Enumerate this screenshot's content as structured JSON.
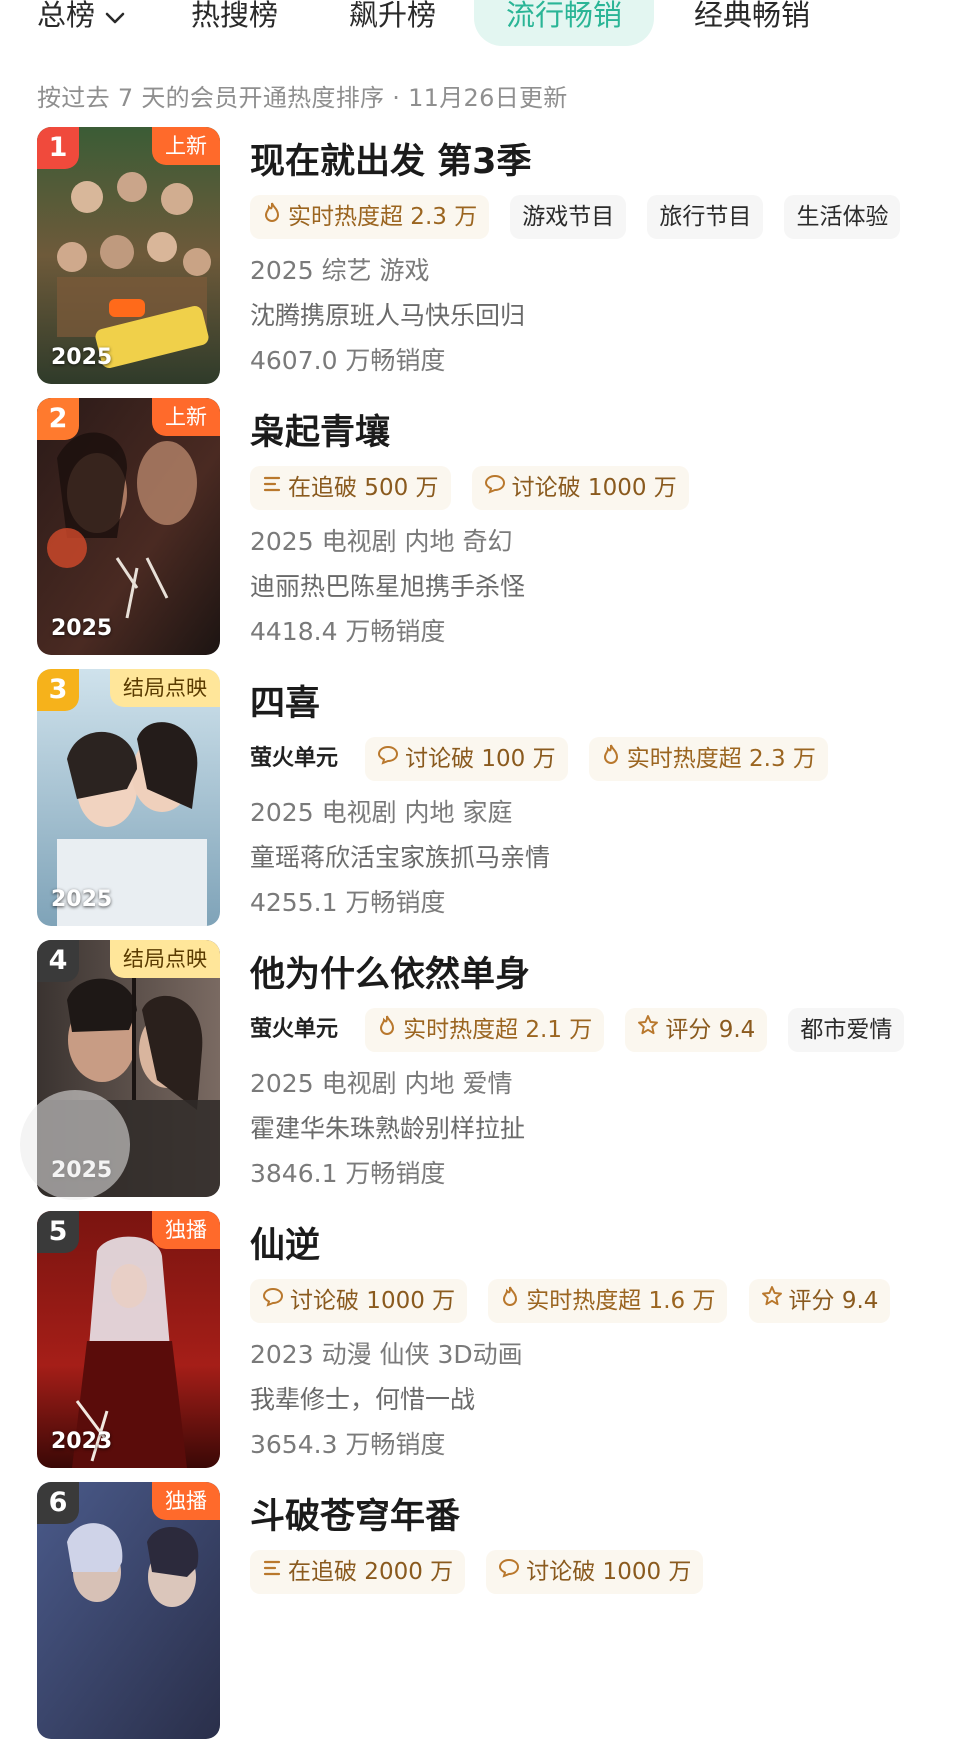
{
  "tabs": [
    {
      "label": "总榜"
    },
    {
      "label": "热搜榜"
    },
    {
      "label": "飙升榜"
    },
    {
      "label": "流行畅销",
      "active": true
    },
    {
      "label": "经典畅销"
    }
  ],
  "subtitle": "按过去 7 天的会员开通热度排序 · 11月26日更新",
  "colors": {
    "accent": "#2ab596",
    "rank1": "#f04a3c",
    "rank2": "#ff7a2e",
    "rank3": "#f6b21b",
    "rank_other": "#3a3a3a",
    "badge": "#ff6a2b"
  },
  "items": [
    {
      "rank": "1",
      "badge": "上新",
      "year": "2025",
      "title": "现在就出发 第3季",
      "tags": [
        {
          "icon": "flame-icon",
          "text": "实时热度超 2.3 万"
        },
        {
          "text": "游戏节目"
        },
        {
          "text": "旅行节目"
        },
        {
          "text": "生活体验"
        }
      ],
      "genre": "2025 综艺 游戏",
      "desc": "沈腾携原班人马快乐回归",
      "sales": "4607.0 万畅销度"
    },
    {
      "rank": "2",
      "badge": "上新",
      "year": "2025",
      "title": "枭起青壤",
      "tags": [
        {
          "icon": "list-icon",
          "text": "在追破 500 万"
        },
        {
          "icon": "chat-icon",
          "text": "讨论破 1000 万"
        }
      ],
      "genre": "2025 电视剧 内地 奇幻",
      "desc": "迪丽热巴陈星旭携手杀怪",
      "sales": "4418.4 万畅销度"
    },
    {
      "rank": "3",
      "badge": "结局点映",
      "year": "2025",
      "title": "四喜",
      "tags": [
        {
          "brand": "萤火单元"
        },
        {
          "icon": "chat-icon",
          "text": "讨论破 100 万"
        },
        {
          "icon": "flame-icon",
          "text": "实时热度超 2.3 万"
        }
      ],
      "genre": "2025 电视剧 内地 家庭",
      "desc": "童瑶蒋欣活宝家族抓马亲情",
      "sales": "4255.1 万畅销度"
    },
    {
      "rank": "4",
      "badge": "结局点映",
      "year": "2025",
      "title": "他为什么依然单身",
      "tags": [
        {
          "brand": "萤火单元"
        },
        {
          "icon": "flame-icon",
          "text": "实时热度超 2.1 万"
        },
        {
          "icon": "star-icon",
          "text": "评分 9.4"
        },
        {
          "text": "都市爱情"
        }
      ],
      "genre": "2025 电视剧 内地 爱情",
      "desc": "霍建华朱珠熟龄别样拉扯",
      "sales": "3846.1 万畅销度"
    },
    {
      "rank": "5",
      "badge": "独播",
      "year": "2023",
      "title": "仙逆",
      "tags": [
        {
          "icon": "chat-icon",
          "text": "讨论破 1000 万"
        },
        {
          "icon": "flame-icon",
          "text": "实时热度超 1.6 万"
        },
        {
          "icon": "star-icon",
          "text": "评分 9.4"
        }
      ],
      "genre": "2023 动漫 仙侠 3D动画",
      "desc": "我辈修士，何惜一战",
      "sales": "3654.3 万畅销度"
    },
    {
      "rank": "6",
      "badge": "独播",
      "year": "",
      "title": "斗破苍穹年番",
      "tags": [
        {
          "icon": "list-icon",
          "text": "在追破 2000 万"
        },
        {
          "icon": "chat-icon",
          "text": "讨论破 1000 万"
        }
      ],
      "genre": "",
      "desc": "",
      "sales": ""
    }
  ]
}
